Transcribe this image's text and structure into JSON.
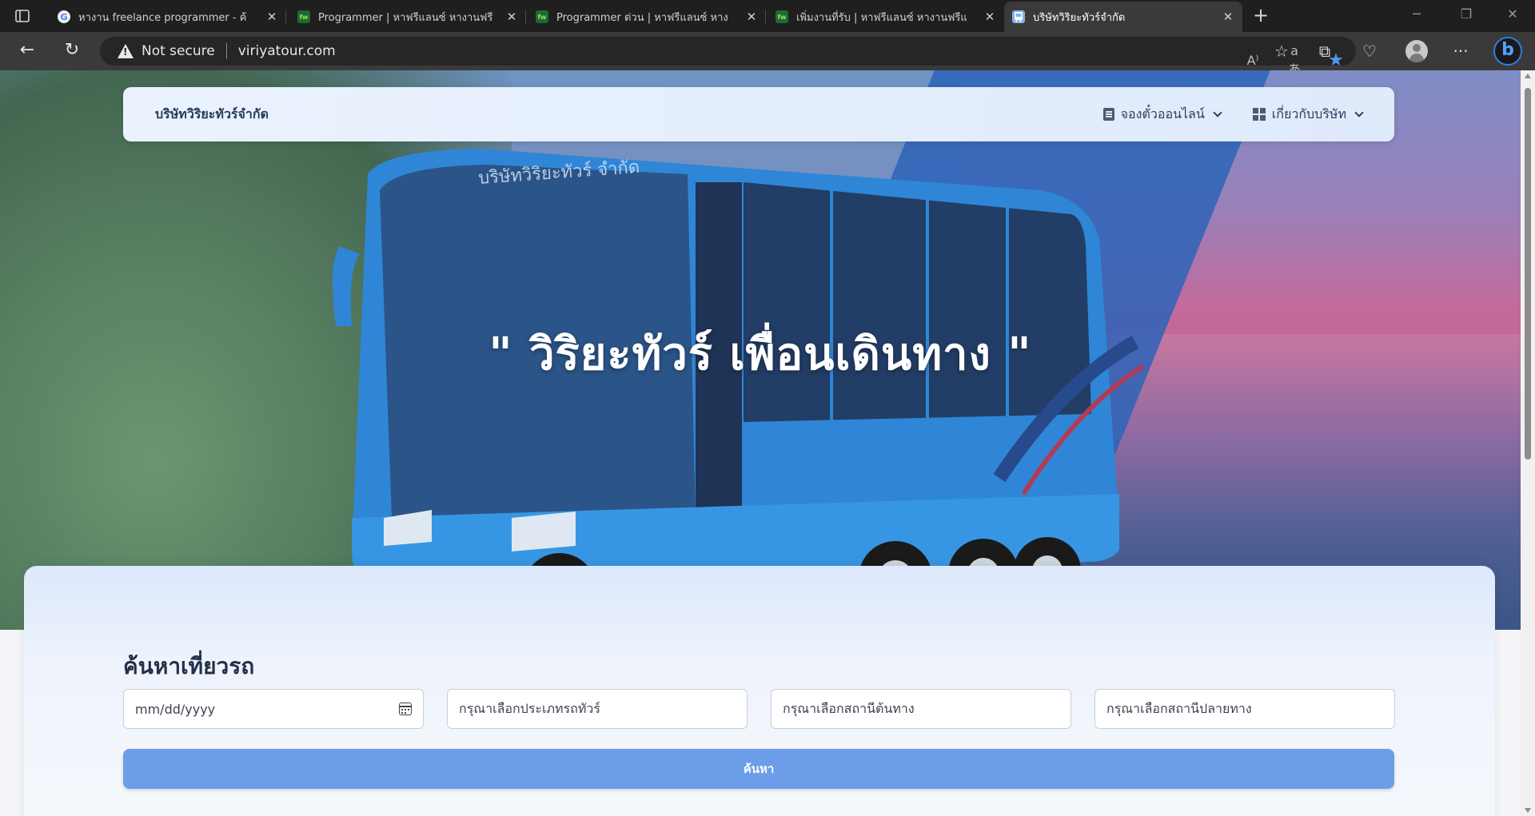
{
  "browser": {
    "tabs": [
      {
        "title": "หางาน freelance programmer - ค้",
        "favicon": "google-icon",
        "active": false
      },
      {
        "title": "Programmer | หาฟรีแลนซ์ หางานฟรี",
        "favicon": "fastwork-icon",
        "active": false
      },
      {
        "title": "Programmer ด่วน | หาฟรีแลนซ์ หาง",
        "favicon": "fastwork-icon",
        "active": false
      },
      {
        "title": "เพิ่มงานที่รับ | หาฟรีแลนซ์ หางานฟรีแ",
        "favicon": "fastwork-icon",
        "active": false
      },
      {
        "title": "บริษัทวิริยะทัวร์จำกัด",
        "favicon": "bus-icon",
        "active": true
      }
    ],
    "security_label": "Not secure",
    "url": "viriyatour.com"
  },
  "page": {
    "brand": "บริษัทวิริยะทัวร์จำกัด",
    "nav": {
      "booking": "จองตั๋วออนไลน์",
      "about": "เกี่ยวกับบริษัท"
    },
    "hero": {
      "slogan": "\" วิริยะทัวร์ เพื่อนเดินทาง \"",
      "bus_decal": "บริษัทวิริยะทัวร์ จำกัด"
    },
    "search": {
      "title": "ค้นหาเที่ยวรถ",
      "date_placeholder": "mm/dd/yyyy",
      "bus_type_placeholder": "กรุณาเลือกประเภทรถทัวร์",
      "origin_placeholder": "กรุณาเลือกสถานีต้นทาง",
      "destination_placeholder": "กรุณาเลือกสถานีปลายทาง",
      "button_label": "ค้นหา"
    }
  },
  "colors": {
    "accent": "#6c9de9",
    "bus_blue": "#2f86d6",
    "navbar_bg": "#e3edfc"
  }
}
